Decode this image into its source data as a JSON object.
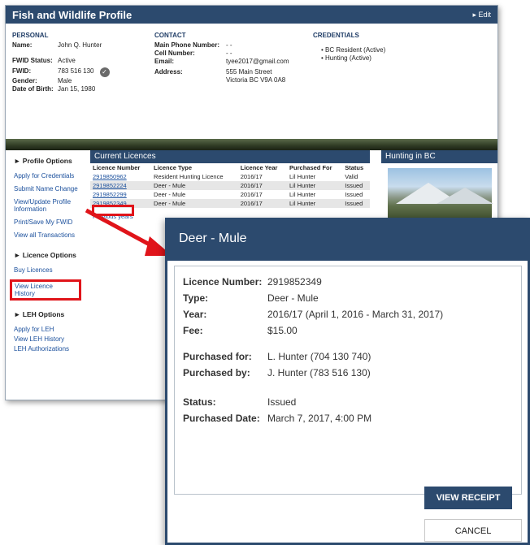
{
  "profile": {
    "title": "Fish and Wildlife Profile",
    "edit_label": "▸ Edit",
    "personal": {
      "heading": "PERSONAL",
      "name_label": "Name:",
      "name": "John Q. Hunter",
      "fwid_status_label": "FWID Status:",
      "fwid_status": "Active",
      "fwid_label": "FWID:",
      "fwid": "783 516 130",
      "gender_label": "Gender:",
      "gender": "Male",
      "dob_label": "Date of Birth:",
      "dob": "Jan 15, 1980"
    },
    "contact": {
      "heading": "CONTACT",
      "main_phone_label": "Main Phone Number:",
      "main_phone": "- -",
      "cell_label": "Cell Number:",
      "cell": "- -",
      "email_label": "Email:",
      "email": "tyee2017@gmail.com",
      "address_label": "Address:",
      "address_line1": "555 Main Street",
      "address_line2": "Victoria BC V9A 0A8"
    },
    "credentials": {
      "heading": "CREDENTIALS",
      "items": [
        "BC Resident (Active)",
        "Hunting (Active)"
      ]
    }
  },
  "nav": {
    "profile_options": "► Profile Options",
    "profile_links": [
      "Apply for Credentials",
      "Submit Name Change",
      "View/Update Profile Information",
      "Print/Save My FWID",
      "View all Transactions"
    ],
    "licence_options": "► Licence Options",
    "licence_links": [
      "Buy Licences",
      "View Licence History"
    ],
    "leh_options": "► LEH Options",
    "leh_links": [
      "Apply for LEH",
      "View LEH History",
      "LEH Authorizations"
    ]
  },
  "licences": {
    "title": "Current Licences",
    "columns": [
      "Licence Number",
      "Licence Type",
      "Licence Year",
      "Purchased For",
      "Status"
    ],
    "rows": [
      {
        "number": "2919850962",
        "type": "Resident Hunting Licence",
        "year": "2016/17",
        "for": "Lil Hunter",
        "status": "Valid"
      },
      {
        "number": "2919852224",
        "type": "Deer - Mule",
        "year": "2016/17",
        "for": "Lil Hunter",
        "status": "Issued"
      },
      {
        "number": "2919852299",
        "type": "Deer - Mule",
        "year": "2016/17",
        "for": "Lil Hunter",
        "status": "Issued"
      },
      {
        "number": "2919852349",
        "type": "Deer - Mule",
        "year": "2016/17",
        "for": "Lil Hunter",
        "status": "Issued"
      }
    ],
    "previous_years": "Previous years"
  },
  "hunting": {
    "title": "Hunting in BC"
  },
  "modal": {
    "title": "Deer - Mule",
    "licence_number_label": "Licence Number:",
    "licence_number": "2919852349",
    "type_label": "Type:",
    "type": "Deer - Mule",
    "year_label": "Year:",
    "year": "2016/17 (April 1, 2016 - March 31, 2017)",
    "fee_label": "Fee:",
    "fee": "$15.00",
    "purchased_for_label": "Purchased for:",
    "purchased_for": "L. Hunter (704 130 740)",
    "purchased_by_label": "Purchased by:",
    "purchased_by": "J. Hunter (783 516 130)",
    "status_label": "Status:",
    "status": "Issued",
    "purchased_date_label": "Purchased Date:",
    "purchased_date": "March 7, 2017, 4:00 PM",
    "view_receipt": "VIEW RECEIPT",
    "cancel": "CANCEL"
  },
  "colors": {
    "header": "#2c4a6e",
    "highlight": "#e0141a",
    "link": "#1a4f9c"
  }
}
